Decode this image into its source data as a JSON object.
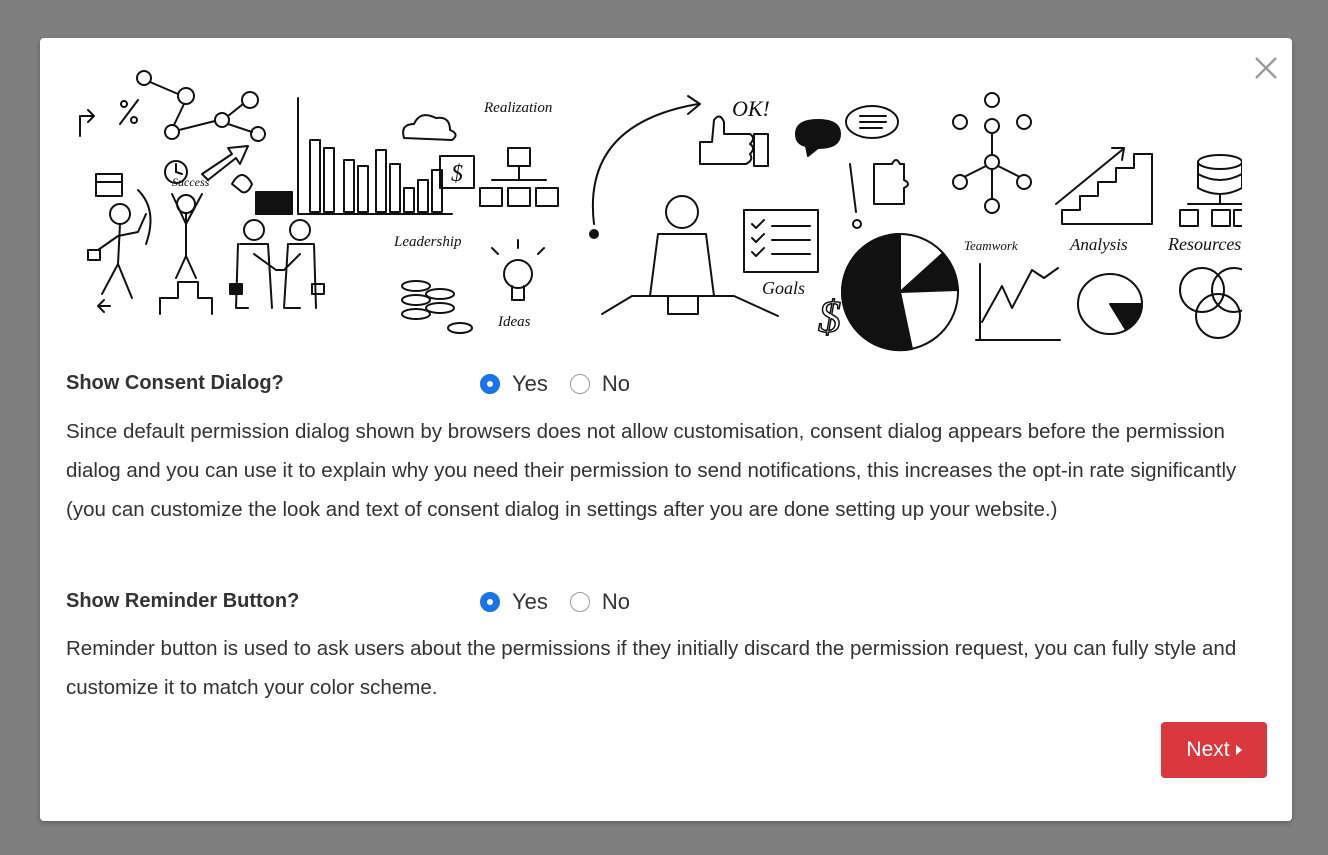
{
  "banner": {
    "labels": {
      "success": "Success",
      "leadership": "Leadership",
      "ideas": "Ideas",
      "realization": "Realization",
      "ok": "OK!",
      "goals": "Goals",
      "teamwork": "Teamwork",
      "analysis": "Analysis",
      "resources": "Resources"
    }
  },
  "consent": {
    "title": "Show Consent Dialog?",
    "yes_label": "Yes",
    "no_label": "No",
    "selected": "Yes",
    "description": "Since default permission dialog shown by browsers does not allow customisation, consent dialog appears before the permission dialog and you can use it to explain why you need their permission to send notifications, this increases the opt-in rate significantly (you can customize the look and text of consent dialog in settings after you are done setting up your website.)"
  },
  "reminder": {
    "title": "Show Reminder Button?",
    "yes_label": "Yes",
    "no_label": "No",
    "selected": "Yes",
    "description": "Reminder button is used to ask users about the permissions if they initially discard the permission request, you can fully style and customize it to match your color scheme."
  },
  "footer": {
    "next_label": "Next"
  },
  "icons": {
    "close": "close-icon",
    "next_caret": "caret-right-icon"
  },
  "colors": {
    "radio_selected": "#1a73e8",
    "next_button": "#d9383f",
    "backdrop": "#7f7f7f"
  }
}
